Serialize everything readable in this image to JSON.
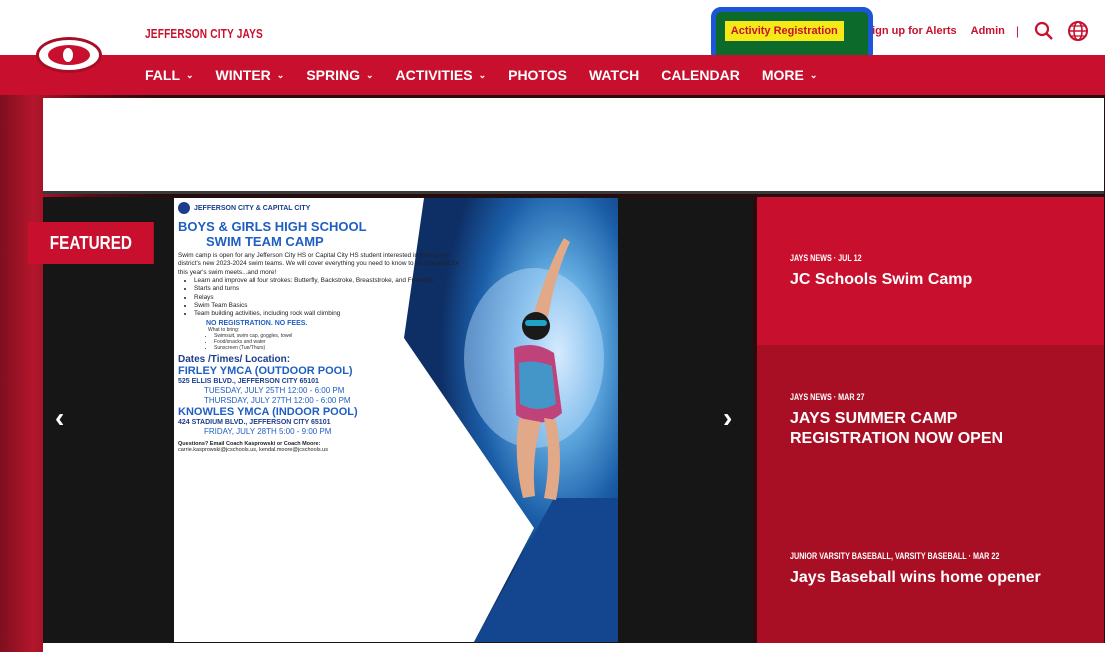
{
  "header": {
    "site_name": "JEFFERSON CITY JAYS",
    "activity_registration": "Activity Registration",
    "alerts": "Sign up for Alerts",
    "admin": "Admin",
    "separator": "|",
    "search_icon": "search-icon",
    "globe_icon": "globe-icon"
  },
  "nav": {
    "items": [
      {
        "label": "FALL",
        "has_menu": true
      },
      {
        "label": "WINTER",
        "has_menu": true
      },
      {
        "label": "SPRING",
        "has_menu": true
      },
      {
        "label": "ACTIVITIES",
        "has_menu": true
      },
      {
        "label": "PHOTOS",
        "has_menu": false
      },
      {
        "label": "WATCH",
        "has_menu": false
      },
      {
        "label": "CALENDAR",
        "has_menu": false
      },
      {
        "label": "MORE",
        "has_menu": true
      }
    ],
    "chevron": "⌄"
  },
  "featured": {
    "tag": "FEATURED",
    "prev_arrow": "‹",
    "next_arrow": "›"
  },
  "flyer": {
    "org": "JEFFERSON CITY & CAPITAL CITY",
    "title_line1": "BOYS & GIRLS HIGH SCHOOL",
    "title_line2": "SWIM TEAM CAMP",
    "body": "Swim camp is open for any Jefferson City HS or Capital City HS student interested in joining the district's new 2023-2024 swim teams. We will cover everything you need to know to be prepared for this year's swim meets...and more!",
    "bullets": [
      "Learn and improve all four strokes: Butterfly, Backstroke, Breaststroke, and Freestyle",
      "Starts and turns",
      "Relays",
      "Swim Team Basics",
      "Team building activities, including rock wall climbing"
    ],
    "no_registration": "NO REGISTRATION. NO FEES.",
    "bring_heading": "What to bring:",
    "bring_items": [
      "Swimsuit, swim cap, goggles, towel",
      "Food/snacks and water",
      "Sunscreen (Tue/Thurs)"
    ],
    "dates_heading": "Dates /Times/ Location:",
    "location1": "FIRLEY YMCA (OUTDOOR POOL)",
    "address1": "525 ELLIS BLVD., JEFFERSON CITY 65101",
    "time1a": "TUESDAY, JULY 25TH 12:00 - 6:00 PM",
    "time1b": "THURSDAY, JULY 27TH 12:00 - 6:00 PM",
    "location2": "KNOWLES YMCA (INDOOR POOL)",
    "address2": "424 STADIUM BLVD., JEFFERSON CITY 65101",
    "time2": "FRIDAY, JULY 28TH 5:00 - 9:00 PM",
    "questions": "Questions? Email Coach Kasprowski or Coach Moore:",
    "emails": "carrie.kasprowski@jcschools.us, kendal.moore@jcschools.us"
  },
  "news": [
    {
      "meta": "JAYS NEWS · JUL 12",
      "title": "JC Schools Swim Camp"
    },
    {
      "meta": "JAYS NEWS · MAR 27",
      "title": "JAYS SUMMER CAMP REGISTRATION NOW OPEN"
    },
    {
      "meta": "JUNIOR VARSITY BASEBALL, VARSITY BASEBALL · MAR 22",
      "title": "Jays Baseball wins home opener"
    }
  ],
  "colors": {
    "brand_red": "#c8102e",
    "dark_red": "#a90f24",
    "highlight_yellow": "#f5ea17",
    "annotation_blue": "#1a56d6",
    "annotation_green": "#0c6b2a"
  }
}
